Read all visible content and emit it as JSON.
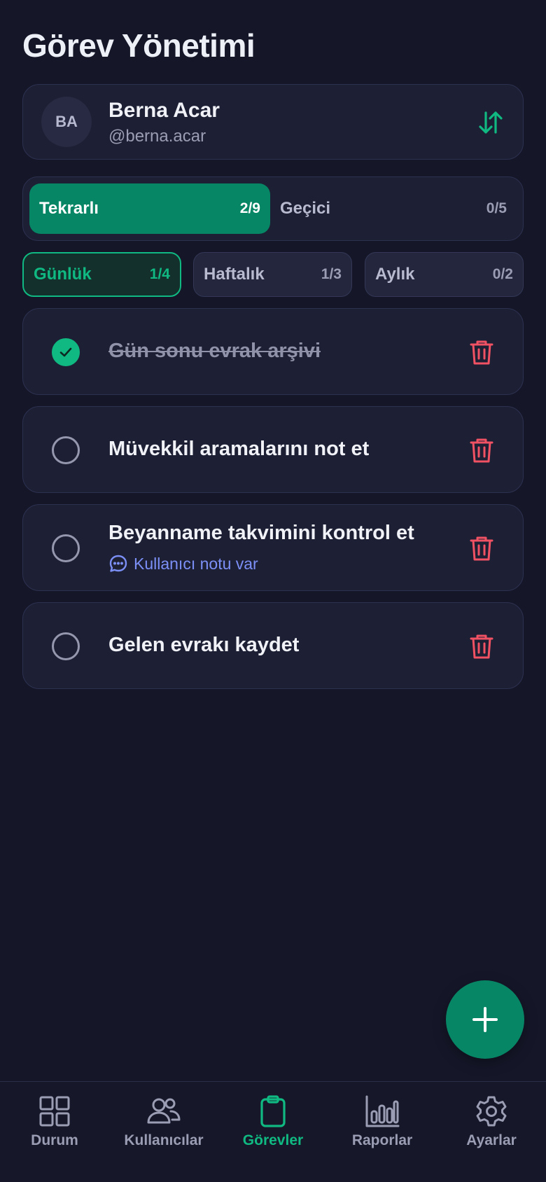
{
  "header": {
    "title": "Görev Yönetimi"
  },
  "user": {
    "initials": "BA",
    "name": "Berna Acar",
    "handle": "@berna.acar",
    "sort_icon": "sort-arrows-icon"
  },
  "segment": {
    "tabs": [
      {
        "label": "Tekrarlı",
        "count": "2/9",
        "active": true
      },
      {
        "label": "Geçici",
        "count": "0/5",
        "active": false
      }
    ]
  },
  "periods": [
    {
      "label": "Günlük",
      "count": "1/4",
      "active": true
    },
    {
      "label": "Haftalık",
      "count": "1/3",
      "active": false
    },
    {
      "label": "Aylık",
      "count": "0/2",
      "active": false
    }
  ],
  "tasks": [
    {
      "title": "Gün sonu evrak arşivi",
      "done": true,
      "note": ""
    },
    {
      "title": "Müvekkil aramalarını not et",
      "done": false,
      "note": ""
    },
    {
      "title": "Beyanname takvimini kontrol et",
      "done": false,
      "note": "Kullanıcı notu var"
    },
    {
      "title": "Gelen evrakı kaydet",
      "done": false,
      "note": ""
    }
  ],
  "fab": {
    "icon": "plus-icon"
  },
  "nav": {
    "items": [
      {
        "label": "Durum",
        "icon": "grid-icon",
        "active": false
      },
      {
        "label": "Kullanıcılar",
        "icon": "users-icon",
        "active": false
      },
      {
        "label": "Görevler",
        "icon": "clipboard-icon",
        "active": true
      },
      {
        "label": "Raporlar",
        "icon": "bar-chart-icon",
        "active": false
      },
      {
        "label": "Ayarlar",
        "icon": "gear-icon",
        "active": false
      }
    ]
  },
  "colors": {
    "background": "#151729",
    "card": "#1d2034",
    "accent": "#10b981",
    "accent_dark": "#078665",
    "danger": "#f05263",
    "note": "#7c8ff7"
  }
}
